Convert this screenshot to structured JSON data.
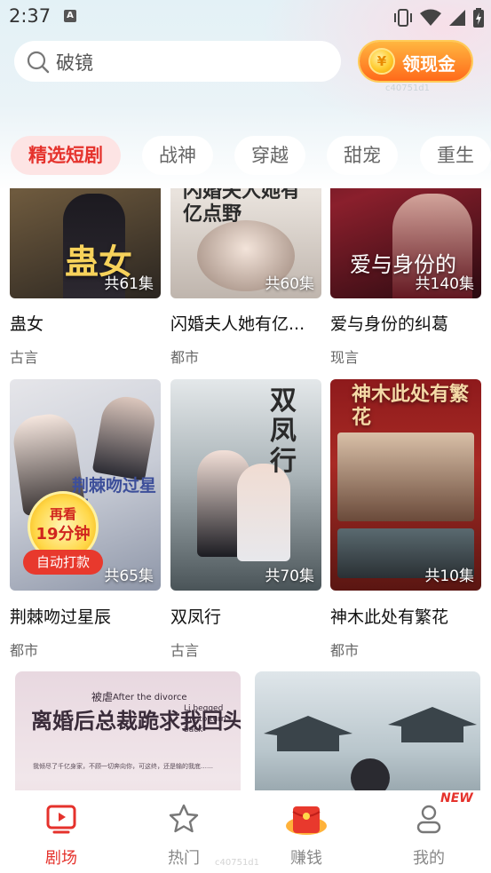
{
  "status_bar": {
    "time": "2:37",
    "a_badge": "A"
  },
  "search": {
    "text": "破镜"
  },
  "cash_button": {
    "label": "领现金",
    "coin_symbol": "¥"
  },
  "watermark": "c40751d1",
  "tabs": [
    {
      "label": "精选短剧",
      "active": true
    },
    {
      "label": "战神",
      "active": false
    },
    {
      "label": "穿越",
      "active": false
    },
    {
      "label": "甜宠",
      "active": false
    },
    {
      "label": "重生",
      "active": false
    }
  ],
  "dramas": [
    {
      "title": "蛊女",
      "genre": "古言",
      "episodes": "共61集",
      "poster_text": "蛊女"
    },
    {
      "title": "闪婚夫人她有亿...",
      "genre": "都市",
      "episodes": "共60集",
      "poster_text": "闪婚夫人她有亿点野"
    },
    {
      "title": "爱与身份的纠葛",
      "genre": "现言",
      "episodes": "共140集",
      "poster_text": "爱与身份的"
    },
    {
      "title": "荆棘吻过星辰",
      "genre": "都市",
      "episodes": "共65集",
      "poster_text": "荆棘吻过星辰"
    },
    {
      "title": "双凤行",
      "genre": "古言",
      "episodes": "共70集",
      "poster_text": "双凤行"
    },
    {
      "title": "神木此处有繁花",
      "genre": "都市",
      "episodes": "共10集",
      "poster_text": "神木此处有繁花"
    }
  ],
  "banner_left": {
    "title_top": "被虐",
    "title_en1": "After the divorce",
    "title_main": "离婚后总裁跪求我回头",
    "title_en2": "Li begged me to turn back",
    "subtitle": "我倾尽了千亿身家，不顾一切奔向你，可这终，还是输的我底……"
  },
  "resume": {
    "line1": "再看",
    "line2": "19分钟",
    "auto": "自动打款"
  },
  "bottom_nav": [
    {
      "label": "剧场",
      "active": true
    },
    {
      "label": "热门",
      "active": false
    },
    {
      "label": "赚钱",
      "active": false
    },
    {
      "label": "我的",
      "active": false
    }
  ],
  "new_badge": "NEW",
  "colors": {
    "accent": "#e5322c",
    "tab_active_bg": "#fde4e4",
    "cash_orange": "#ff6a1a"
  }
}
